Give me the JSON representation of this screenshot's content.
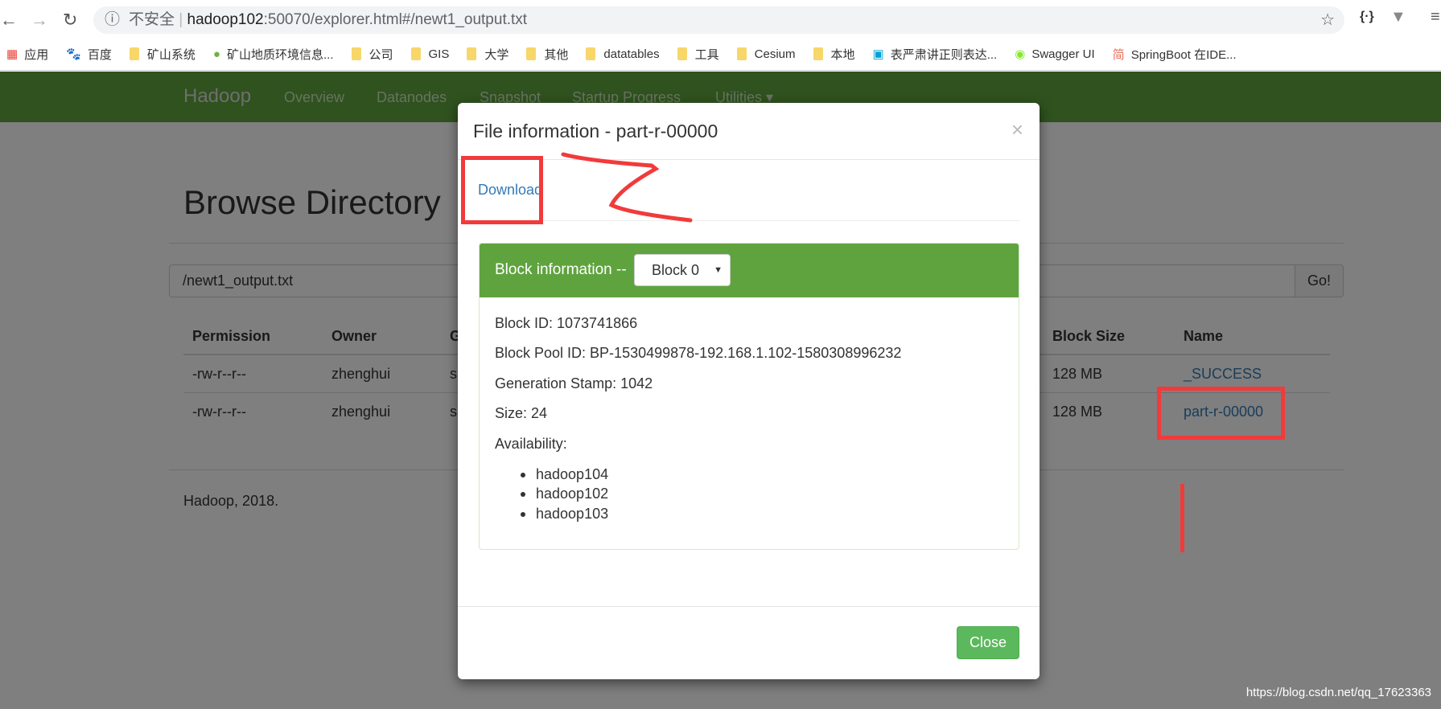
{
  "browser": {
    "security": "不安全",
    "url_host": "hadoop102",
    "url_rest": ":50070/explorer.html#/newt1_output.txt",
    "bookmarks": [
      {
        "label": "应用",
        "icon": "apps-icon"
      },
      {
        "label": "百度",
        "icon": "baidu-icon"
      },
      {
        "label": "矿山系统",
        "icon": "folder-icon"
      },
      {
        "label": "矿山地质环境信息...",
        "icon": "leaf-icon"
      },
      {
        "label": "公司",
        "icon": "folder-icon"
      },
      {
        "label": "GIS",
        "icon": "folder-icon"
      },
      {
        "label": "大学",
        "icon": "folder-icon"
      },
      {
        "label": "其他",
        "icon": "folder-icon"
      },
      {
        "label": "datatables",
        "icon": "folder-icon"
      },
      {
        "label": "工具",
        "icon": "folder-icon"
      },
      {
        "label": "Cesium",
        "icon": "folder-icon"
      },
      {
        "label": "本地",
        "icon": "folder-icon"
      },
      {
        "label": "表严肃讲正则表达...",
        "icon": "bilibili-icon"
      },
      {
        "label": "Swagger UI",
        "icon": "swagger-icon"
      },
      {
        "label": "SpringBoot 在IDE...",
        "icon": "jianshu-icon"
      }
    ]
  },
  "navbar": {
    "brand": "Hadoop",
    "links": [
      "Overview",
      "Datanodes",
      "Snapshot",
      "Startup Progress",
      "Utilities"
    ]
  },
  "page": {
    "title": "Browse Directory",
    "path": "/newt1_output.txt",
    "go": "Go!",
    "headers": [
      "Permission",
      "Owner",
      "G",
      "Block Size",
      "Name"
    ],
    "rows": [
      [
        "-rw-r--r--",
        "zhenghui",
        "s",
        "128 MB",
        "_SUCCESS"
      ],
      [
        "-rw-r--r--",
        "zhenghui",
        "s",
        "128 MB",
        "part-r-00000"
      ]
    ],
    "footer": "Hadoop, 2018."
  },
  "modal": {
    "title": "File information - part-r-00000",
    "close_x": "×",
    "download": "Download",
    "block_label": "Block information --",
    "block_selected": "Block 0",
    "block_id": "Block ID: 1073741866",
    "pool_id": "Block Pool ID: BP-1530499878-192.168.1.102-1580308996232",
    "gen_stamp": "Generation Stamp: 1042",
    "size": "Size: 24",
    "availability": "Availability:",
    "hosts": [
      "hadoop104",
      "hadoop102",
      "hadoop103"
    ],
    "close": "Close"
  },
  "watermark": "https://blog.csdn.net/qq_17623363",
  "colors": {
    "navbar": "#5ea43c",
    "panel_heading": "#5fa33e",
    "close_button": "#5cb85c",
    "annotation": "#f23a3a",
    "link": "#337ab7"
  }
}
